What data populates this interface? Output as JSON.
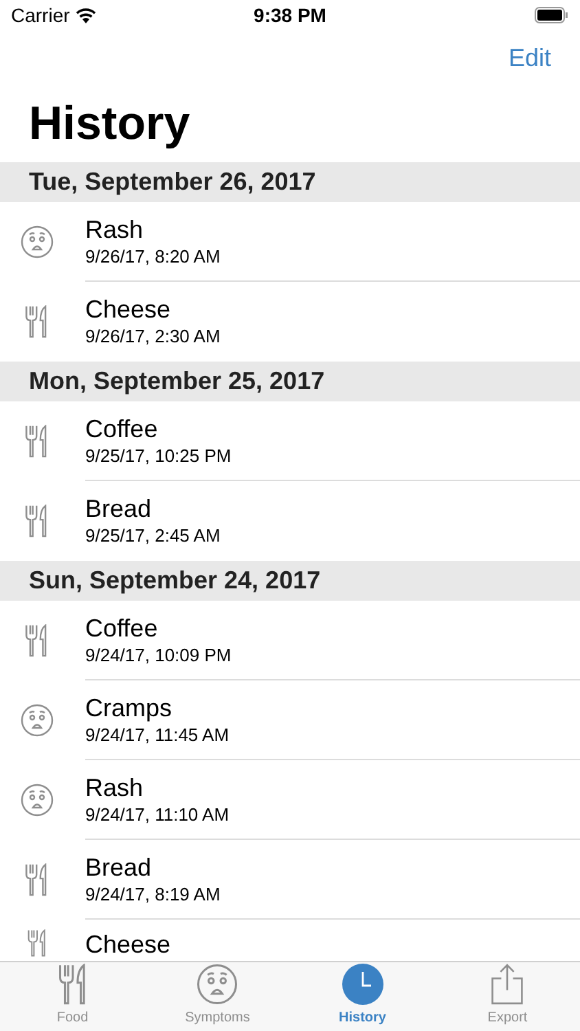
{
  "status_bar": {
    "carrier": "Carrier",
    "time": "9:38 PM"
  },
  "nav": {
    "edit": "Edit",
    "title": "History"
  },
  "sections": [
    {
      "header": "Tue, September 26, 2017",
      "entries": [
        {
          "kind": "symptom",
          "name": "Rash",
          "date": "9/26/17, 8:20 AM"
        },
        {
          "kind": "food",
          "name": "Cheese",
          "date": "9/26/17, 2:30 AM"
        }
      ]
    },
    {
      "header": "Mon, September 25, 2017",
      "entries": [
        {
          "kind": "food",
          "name": "Coffee",
          "date": "9/25/17, 10:25 PM"
        },
        {
          "kind": "food",
          "name": "Bread",
          "date": "9/25/17, 2:45 AM"
        }
      ]
    },
    {
      "header": "Sun, September 24, 2017",
      "entries": [
        {
          "kind": "food",
          "name": "Coffee",
          "date": "9/24/17, 10:09 PM"
        },
        {
          "kind": "symptom",
          "name": "Cramps",
          "date": "9/24/17, 11:45 AM"
        },
        {
          "kind": "symptom",
          "name": "Rash",
          "date": "9/24/17, 11:10 AM"
        },
        {
          "kind": "food",
          "name": "Bread",
          "date": "9/24/17, 8:19 AM"
        },
        {
          "kind": "food",
          "name": "Cheese"
        }
      ]
    }
  ],
  "tabs": [
    {
      "kind": "food",
      "label": "Food",
      "selected": false
    },
    {
      "kind": "symptom",
      "label": "Symptoms",
      "selected": false
    },
    {
      "kind": "history",
      "label": "History",
      "selected": true
    },
    {
      "kind": "export",
      "label": "Export",
      "selected": false
    }
  ]
}
